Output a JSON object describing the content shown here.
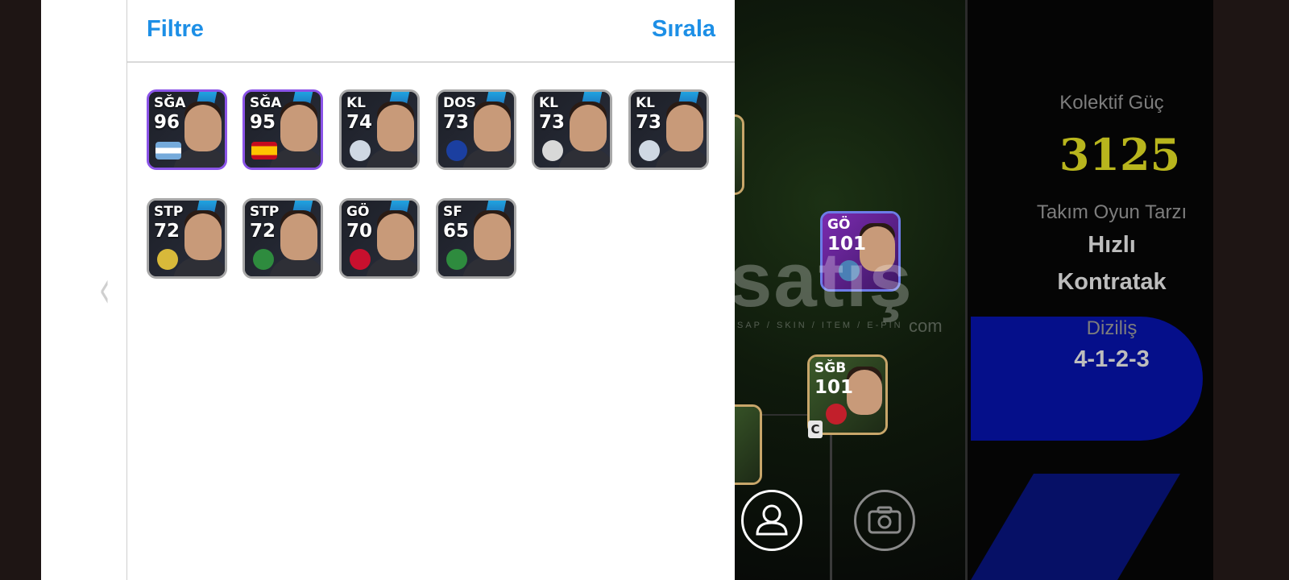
{
  "panel": {
    "filter_label": "Filtre",
    "sort_label": "Sırala"
  },
  "players": [
    {
      "position": "SĞA",
      "rating": "96",
      "badge": "argentina-flag"
    },
    {
      "position": "SĞA",
      "rating": "95",
      "badge": "spain-flag"
    },
    {
      "position": "KL",
      "rating": "74",
      "badge": "club-crest"
    },
    {
      "position": "DOS",
      "rating": "73",
      "badge": "inter-crest"
    },
    {
      "position": "KL",
      "rating": "73",
      "badge": "club-crest"
    },
    {
      "position": "KL",
      "rating": "73",
      "badge": "club-crest"
    },
    {
      "position": "STP",
      "rating": "72",
      "badge": "club-crest"
    },
    {
      "position": "STP",
      "rating": "72",
      "badge": "club-crest"
    },
    {
      "position": "GÖ",
      "rating": "70",
      "badge": "rennes-crest"
    },
    {
      "position": "SF",
      "rating": "65",
      "badge": "sassuolo-crest"
    }
  ],
  "pitch": {
    "card_go": {
      "position": "GÖ",
      "rating": "101"
    },
    "card_sgb": {
      "position": "SĞB",
      "rating": "101"
    },
    "captain_badge": "C"
  },
  "watermark": {
    "brand": "satış",
    "sub": "SAP / SKIN / ITEM / E-PIN",
    "com": "com"
  },
  "stats": {
    "collective_label": "Kolektif Güç",
    "collective_value": "3125",
    "playstyle_label": "Takım Oyun Tarzı",
    "playstyle_value_1": "Hızlı",
    "playstyle_value_2": "Kontratak",
    "formation_label": "Diziliş",
    "formation_value": "4-1-2-3"
  },
  "colors": {
    "accent": "#1d8fe6",
    "power": "#b8b51d",
    "formation_bg": "#050f8a"
  }
}
